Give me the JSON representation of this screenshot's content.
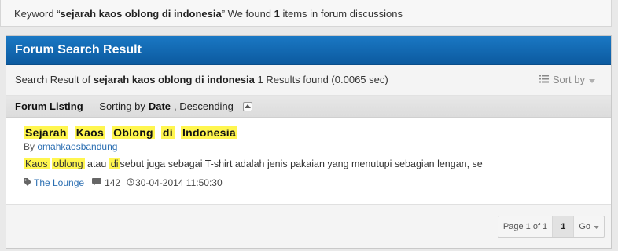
{
  "keyword_bar": {
    "prefix": "Keyword “",
    "keyword": "sejarah kaos oblong di indonesia",
    "middle": "” We found ",
    "count": "1",
    "suffix": " items in forum discussions"
  },
  "panel": {
    "title": "Forum Search Result",
    "results": {
      "prefix": "Search Result of ",
      "query": "sejarah kaos oblong di indonesia",
      "summary": " 1 Results found (0.0065 sec)"
    },
    "sort_by_label": "Sort by",
    "listing": {
      "label": "Forum Listing",
      "sorting_prefix": "— Sorting by ",
      "sort_field": "Date",
      "sort_order": ", Descending"
    }
  },
  "result": {
    "title_words": [
      "Sejarah",
      "Kaos",
      "Oblong",
      "di",
      "Indonesia"
    ],
    "by_label": "By ",
    "author": "omahkaosbandung",
    "snippet": {
      "hl1": "Kaos",
      "hl2": "oblong",
      "text1": " atau ",
      "hl3": "di",
      "text2": "sebut juga sebagai T-shirt adalah jenis pakaian yang menutupi sebagian lengan, se"
    },
    "forum": "The Lounge",
    "replies": "142",
    "date": "30-04-2014 11:50:30"
  },
  "pagination": {
    "page_info": "Page 1 of 1",
    "current": "1",
    "go_label": "Go"
  },
  "icons": {
    "sort": "list-icon",
    "caret": "caret-down-icon",
    "collapse": "collapse-up-icon",
    "tag": "tag-icon",
    "comment": "comment-icon",
    "clock": "clock-icon"
  }
}
